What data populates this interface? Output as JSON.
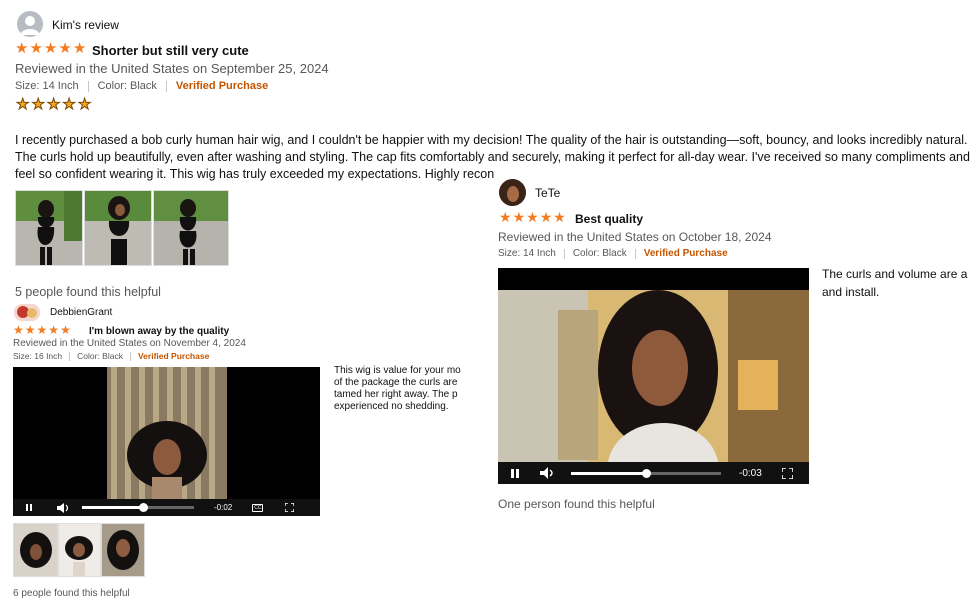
{
  "review1": {
    "reviewer": "Kim's review",
    "rating": 5,
    "title": "Shorter but still very cute",
    "reviewed_in": "Reviewed in the United States on September 25, 2024",
    "size": "Size: 14 Inch",
    "color": "Color: Black",
    "verified": "Verified Purchase",
    "paragraph_line1": "I recently purchased a bob curly human hair wig, and I couldn't be happier with my decision! The quality of the hair is outstanding—soft, bouncy, and looks incredibly natural.",
    "paragraph_line2": "The curls hold up beautifully, even after washing and styling. The cap fits comfortably and securely, making it perfect for all-day wear. I've received so many compliments and",
    "paragraph_line3": "feel so confident wearing it. This wig has truly exceeded my expectations. Highly recon",
    "helpful": "5 people found this helpful"
  },
  "review2": {
    "reviewer": "DebbienGrant",
    "rating": 5,
    "title": "I'm blown away by the quality",
    "reviewed_in": "Reviewed in the United States on November 4, 2024",
    "size": "Size: 16 Inch",
    "color": "Color: Black",
    "verified": "Verified Purchase",
    "text_line1": "This wig is value for your mo",
    "text_line2": "of the package the curls are",
    "text_line3": "tamed her right away. The p",
    "text_line4": "experienced no shedding.",
    "video_time": "-0:02",
    "video_progress": 0.55,
    "cc_label": "CC",
    "helpful": "6 people found this helpful"
  },
  "review3": {
    "reviewer": "TeTe",
    "rating": 5,
    "title": "Best quality",
    "reviewed_in": "Reviewed in the United States on October 18, 2024",
    "size": "Size: 14 Inch",
    "color": "Color: Black",
    "verified": "Verified Purchase",
    "text_line1": "The curls and volume are a",
    "text_line2": "and install.",
    "video_time": "-0:03",
    "video_progress": 0.5,
    "helpful": "One person found this helpful"
  },
  "icons": {
    "star": "★",
    "play_pause": "pause-icon",
    "volume": "volume-icon",
    "fullscreen": "fullscreen-icon",
    "captions": "captions-icon"
  },
  "colors": {
    "star": "#f47b20",
    "verified": "#c45500",
    "meta": "#565959"
  }
}
